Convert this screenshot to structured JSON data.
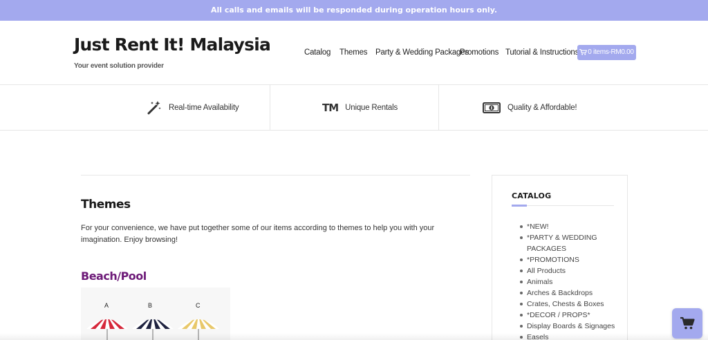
{
  "announcement": "All calls and emails will be responded during operation hours only.",
  "brand": {
    "title": "Just Rent It! Malaysia",
    "tagline": "Your event solution provider"
  },
  "nav": {
    "items": [
      "Catalog",
      "Themes",
      "Party & Wedding Packages",
      "Promotions",
      "Tutorial & Instructions"
    ],
    "cart_label": "0 items-RM0.00",
    "cart_icon": "cart-icon"
  },
  "features": [
    {
      "icon": "magic-wand-icon",
      "label": "Real-time Availability"
    },
    {
      "icon": "trademark-icon",
      "glyph": "TM",
      "label": "Unique Rentals"
    },
    {
      "icon": "money-icon",
      "label": "Quality & Affordable!"
    }
  ],
  "main": {
    "title": "Themes",
    "intro": "For your convenience, we have put together some of our items according to themes to help you with your imagination. Enjoy browsing!",
    "section_title": "Beach/Pool",
    "image_labels": [
      "A",
      "B",
      "C"
    ]
  },
  "sidebar": {
    "title": "CATALOG",
    "items": [
      "*NEW!",
      "*PARTY & WEDDING PACKAGES",
      "*PROMOTIONS",
      "All Products",
      "Animals",
      "Arches & Backdrops",
      "Crates, Chests & Boxes",
      "*DECOR / PROPS*",
      "Display Boards & Signages",
      "Easels"
    ]
  },
  "colors": {
    "accent": "#a3a9ee",
    "section_title": "#6d1a78",
    "topbar_text": "#ffffff"
  }
}
